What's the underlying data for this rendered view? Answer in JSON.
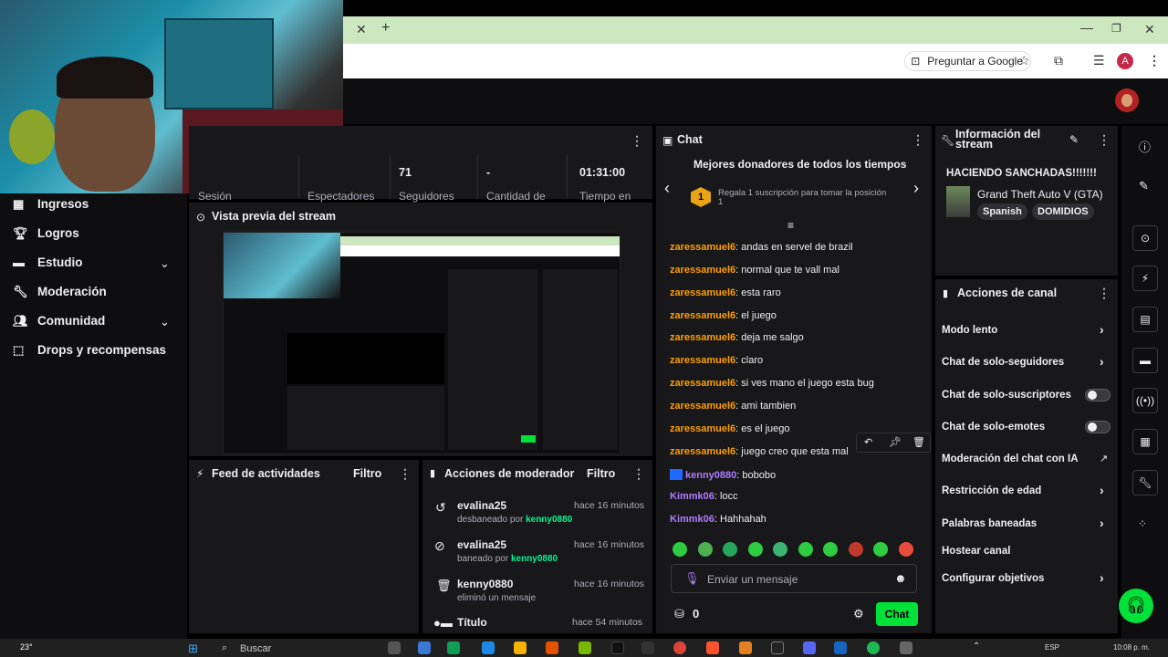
{
  "browser": {
    "ask_google": "Preguntar a Google",
    "profile_initial": "A"
  },
  "sidebar": {
    "items": [
      {
        "label": "Ingresos",
        "icon": "revenue-icon"
      },
      {
        "label": "Logros",
        "icon": "trophy-icon"
      },
      {
        "label": "Estudio",
        "icon": "studio-icon"
      },
      {
        "label": "Moderación",
        "icon": "wrench-icon"
      },
      {
        "label": "Comunidad",
        "icon": "community-icon"
      },
      {
        "label": "Drops y recompensas",
        "icon": "drops-icon"
      }
    ]
  },
  "stats": {
    "items": [
      {
        "value": "",
        "label": "Sesión"
      },
      {
        "value": "",
        "label": "Espectadores"
      },
      {
        "value": "71",
        "label": "Seguidores"
      },
      {
        "value": "-",
        "label": "Cantidad de"
      },
      {
        "value": "01:31:00",
        "label": "Tiempo en"
      }
    ]
  },
  "preview": {
    "title": "Vista previa del stream"
  },
  "activity": {
    "title": "Feed de actividades",
    "filter": "Filtro"
  },
  "mod_actions": {
    "title": "Acciones de moderador",
    "filter": "Filtro",
    "entries": [
      {
        "name": "evalina25",
        "action": "desbaneado por",
        "by": "kenny0880",
        "time": "hace 16 minutos",
        "icon": "undo-icon"
      },
      {
        "name": "evalina25",
        "action": "baneado por",
        "by": "kenny0880",
        "time": "hace 16 minutos",
        "icon": "ban-icon"
      },
      {
        "name": "kenny0880",
        "action": "eliminó un mensaje",
        "by": "",
        "time": "hace 16 minutos",
        "icon": "trash-icon"
      },
      {
        "name": "Título",
        "action": "",
        "by": "",
        "time": "hace 54 minutos",
        "icon": "title-icon"
      }
    ]
  },
  "chat": {
    "title": "Chat",
    "donors_title": "Mejores donadores de todos los tiempos",
    "gift_rank": "1",
    "gift_text": "Regala 1 suscripción para tomar la posición 1",
    "messages": [
      {
        "user": "zaressamuel6",
        "text": ": andas en servel de brazil",
        "color": "orange"
      },
      {
        "user": "zaressamuel6",
        "text": ": normal que te vall mal",
        "color": "orange"
      },
      {
        "user": "zaressamuel6",
        "text": ": esta raro",
        "color": "orange"
      },
      {
        "user": "zaressamuel6",
        "text": ": el juego",
        "color": "orange"
      },
      {
        "user": "zaressamuel6",
        "text": ": deja me salgo",
        "color": "orange"
      },
      {
        "user": "zaressamuel6",
        "text": ": claro",
        "color": "orange"
      },
      {
        "user": "zaressamuel6",
        "text": ": si ves mano el juego esta bug",
        "color": "orange"
      },
      {
        "user": "zaressamuel6",
        "text": ": ami tambien",
        "color": "orange"
      },
      {
        "user": "zaressamuel6",
        "text": ": es el juego",
        "color": "orange"
      },
      {
        "user": "zaressamuel6",
        "text": ": juego creo que esta mal",
        "color": "orange"
      },
      {
        "user": "kenny0880",
        "text": ": bobobo",
        "color": "purple"
      },
      {
        "user": "Kimmk06",
        "text": ": locc",
        "color": "purple"
      },
      {
        "user": "Kimmk06",
        "text": ": Hahhahah",
        "color": "purple"
      }
    ],
    "input_placeholder": "Enviar un mensaje",
    "points": "0",
    "send_label": "Chat"
  },
  "stream_info": {
    "title": "Información del stream",
    "stream_title": "HACIENDO SANCHADAS!!!!!!!",
    "game": "Grand Theft Auto V (GTA)",
    "tags": [
      "Spanish",
      "DOMIDIOS"
    ]
  },
  "channel_actions": {
    "title": "Acciones de canal",
    "items": [
      {
        "label": "Modo lento",
        "control": "arrow"
      },
      {
        "label": "Chat de solo-seguidores",
        "control": "arrow"
      },
      {
        "label": "Chat de solo-suscriptores",
        "control": "toggle"
      },
      {
        "label": "Chat de solo-emotes",
        "control": "toggle"
      },
      {
        "label": "Moderación del chat con IA",
        "control": "external"
      },
      {
        "label": "Restricción de edad",
        "control": "arrow"
      },
      {
        "label": "Palabras baneadas",
        "control": "arrow"
      },
      {
        "label": "Hostear canal",
        "control": "none"
      },
      {
        "label": "Configurar objetivos",
        "control": "arrow"
      }
    ]
  },
  "taskbar": {
    "temp": "23°",
    "search": "Buscar",
    "lang": "ESP",
    "time": "10:08 p. m."
  },
  "colors": {
    "accent_green": "#00f593",
    "send_button": "#00e13a",
    "orange_user": "#ff9f00",
    "purple_user": "#b07bff"
  }
}
